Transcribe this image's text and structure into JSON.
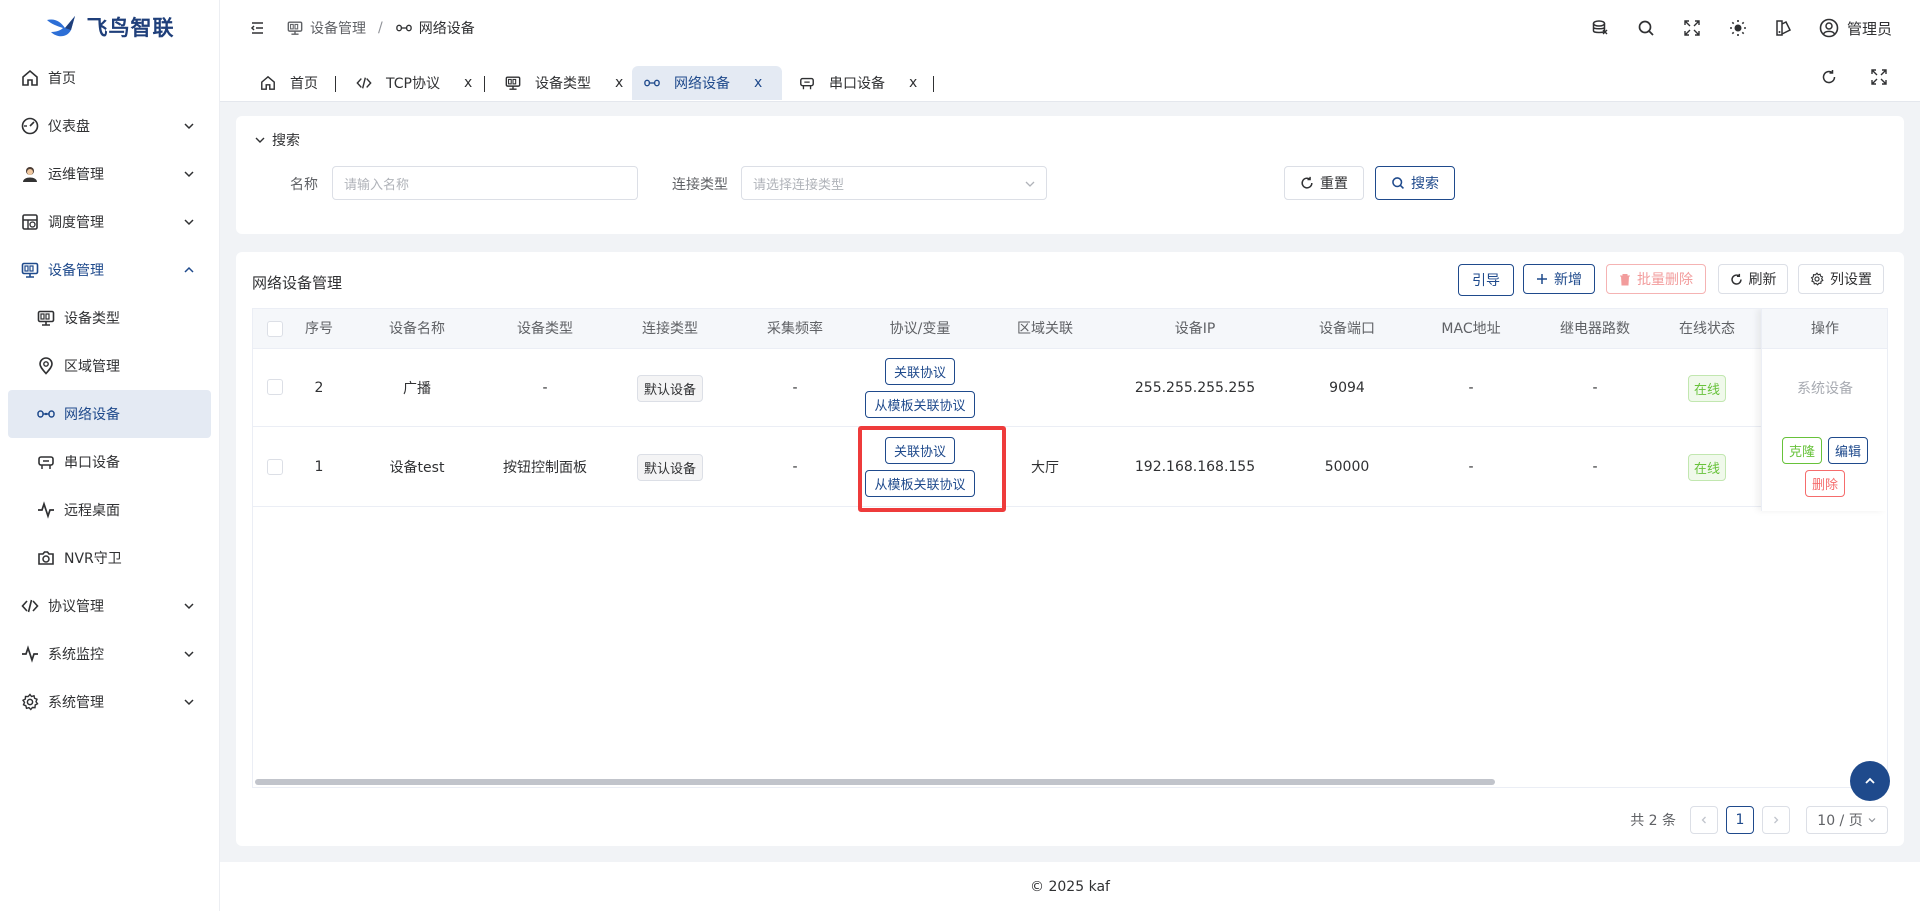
{
  "app": {
    "name": "飞鸟智联",
    "accent": "#1f4a8c",
    "footer": "© 2025 kaf"
  },
  "sidebar": {
    "items": [
      {
        "label": "首页",
        "icon": "home-icon"
      },
      {
        "label": "仪表盘",
        "icon": "dashboard-icon"
      },
      {
        "label": "运维管理",
        "icon": "user-avatar-icon"
      },
      {
        "label": "调度管理",
        "icon": "schedule-icon"
      },
      {
        "label": "设备管理",
        "icon": "device-icon"
      },
      {
        "label": "设备类型",
        "icon": "device-type-icon"
      },
      {
        "label": "区域管理",
        "icon": "location-icon"
      },
      {
        "label": "网络设备",
        "icon": "network-icon"
      },
      {
        "label": "串口设备",
        "icon": "serial-icon"
      },
      {
        "label": "远程桌面",
        "icon": "pulse-icon"
      },
      {
        "label": "NVR守卫",
        "icon": "camera-icon"
      },
      {
        "label": "协议管理",
        "icon": "code-icon"
      },
      {
        "label": "系统监控",
        "icon": "monitor-pulse-icon"
      },
      {
        "label": "系统管理",
        "icon": "gear-icon"
      }
    ]
  },
  "header": {
    "breadcrumb": [
      "设备管理",
      "网络设备"
    ],
    "user": "管理员"
  },
  "tabs": [
    {
      "label": "首页"
    },
    {
      "label": "TCP协议"
    },
    {
      "label": "设备类型"
    },
    {
      "label": "网络设备"
    },
    {
      "label": "串口设备"
    }
  ],
  "tab_close": "x",
  "search": {
    "title": "搜索",
    "name_label": "名称",
    "name_placeholder": "请输入名称",
    "conn_label": "连接类型",
    "conn_placeholder": "请选择连接类型",
    "reset": "重置",
    "search": "搜索"
  },
  "table": {
    "title": "网络设备管理",
    "buttons": {
      "guide": "引导",
      "add": "新增",
      "batch_delete": "批量删除",
      "refresh": "刷新",
      "columns": "列设置"
    },
    "columns": [
      "序号",
      "设备名称",
      "设备类型",
      "连接类型",
      "采集频率",
      "协议/变量",
      "区域关联",
      "设备IP",
      "设备端口",
      "MAC地址",
      "继电器路数",
      "在线状态",
      "操作"
    ],
    "rows": [
      {
        "no": "2",
        "name": "广播",
        "type": "-",
        "conn": "默认设备",
        "freq": "-",
        "proto1": "关联协议",
        "proto2": "从模板关联协议",
        "area": "",
        "ip": "255.255.255.255",
        "port": "9094",
        "mac": "-",
        "relay": "-",
        "status": "在线",
        "op_system": "系统设备"
      },
      {
        "no": "1",
        "name": "设备test",
        "type": "按钮控制面板",
        "conn": "默认设备",
        "freq": "-",
        "proto1": "关联协议",
        "proto2": "从模板关联协议",
        "area": "大厅",
        "ip": "192.168.168.155",
        "port": "50000",
        "mac": "-",
        "relay": "-",
        "status": "在线",
        "op_clone": "克隆",
        "op_edit": "编辑",
        "op_delete": "删除"
      }
    ]
  },
  "pagination": {
    "total": "共 2 条",
    "page": "1",
    "size": "10 / 页"
  }
}
